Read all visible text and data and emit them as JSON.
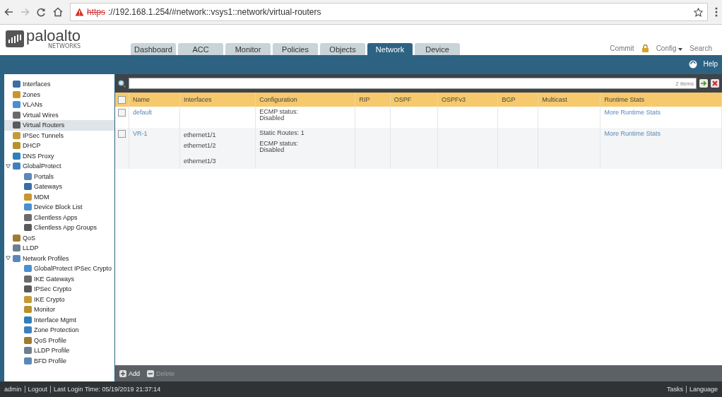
{
  "browser": {
    "url_scheme": "https",
    "url_rest": "://192.168.1.254/#network::vsys1::network/virtual-routers"
  },
  "logo": {
    "name": "paloalto",
    "sub": "NETWORKS"
  },
  "tabs": [
    {
      "label": "Dashboard",
      "selected": false
    },
    {
      "label": "ACC",
      "selected": false
    },
    {
      "label": "Monitor",
      "selected": false
    },
    {
      "label": "Policies",
      "selected": false
    },
    {
      "label": "Objects",
      "selected": false
    },
    {
      "label": "Network",
      "selected": true
    },
    {
      "label": "Device",
      "selected": false
    }
  ],
  "header_actions": {
    "commit": "Commit",
    "config": "Config",
    "search": "Search"
  },
  "help": "Help",
  "sidebar": {
    "items": [
      {
        "label": "Interfaces",
        "selected": false
      },
      {
        "label": "Zones",
        "selected": false
      },
      {
        "label": "VLANs",
        "selected": false
      },
      {
        "label": "Virtual Wires",
        "selected": false
      },
      {
        "label": "Virtual Routers",
        "selected": true
      },
      {
        "label": "IPSec Tunnels",
        "selected": false
      },
      {
        "label": "DHCP",
        "selected": false
      },
      {
        "label": "DNS Proxy",
        "selected": false
      },
      {
        "label": "GlobalProtect",
        "selected": false,
        "expanded": true,
        "children": [
          {
            "label": "Portals",
            "selected": false
          },
          {
            "label": "Gateways",
            "selected": false
          },
          {
            "label": "MDM",
            "selected": false
          },
          {
            "label": "Device Block List",
            "selected": false
          },
          {
            "label": "Clientless Apps",
            "selected": false
          },
          {
            "label": "Clientless App Groups",
            "selected": false
          }
        ]
      },
      {
        "label": "QoS",
        "selected": false
      },
      {
        "label": "LLDP",
        "selected": false
      },
      {
        "label": "Network Profiles",
        "selected": false,
        "expanded": true,
        "children": [
          {
            "label": "GlobalProtect IPSec Crypto",
            "selected": false
          },
          {
            "label": "IKE Gateways",
            "selected": false
          },
          {
            "label": "IPSec Crypto",
            "selected": false
          },
          {
            "label": "IKE Crypto",
            "selected": false
          },
          {
            "label": "Monitor",
            "selected": false
          },
          {
            "label": "Interface Mgmt",
            "selected": false
          },
          {
            "label": "Zone Protection",
            "selected": false
          },
          {
            "label": "QoS Profile",
            "selected": false
          },
          {
            "label": "LLDP Profile",
            "selected": false
          },
          {
            "label": "BFD Profile",
            "selected": false
          }
        ]
      }
    ]
  },
  "filter": {
    "count": "2 items"
  },
  "table": {
    "select_all_checked": false,
    "columns": [
      "Name",
      "Interfaces",
      "Configuration",
      "RIP",
      "OSPF",
      "OSPFv3",
      "BGP",
      "Multicast",
      "Runtime Stats"
    ],
    "rows": [
      {
        "name": "default",
        "checked": false,
        "interfaces": [],
        "configuration": [
          "ECMP status:\nDisabled"
        ],
        "runtime_stats": "More Runtime Stats"
      },
      {
        "name": "VR-1",
        "checked": false,
        "interfaces": [
          "ethernet1/1",
          "ethernet1/2",
          "ethernet1/3"
        ],
        "configuration": [
          "Static Routes: 1",
          "ECMP status:\nDisabled"
        ],
        "runtime_stats": "More Runtime Stats"
      }
    ]
  },
  "footer": [
    {
      "label": "Add",
      "disabled": false
    },
    {
      "label": "Delete",
      "disabled": true
    }
  ],
  "status_bar": {
    "user": "admin",
    "logout": "Logout",
    "last_login": "Last Login Time: 05/19/2019 21:37:14",
    "tasks": "Tasks",
    "language": "Language"
  }
}
